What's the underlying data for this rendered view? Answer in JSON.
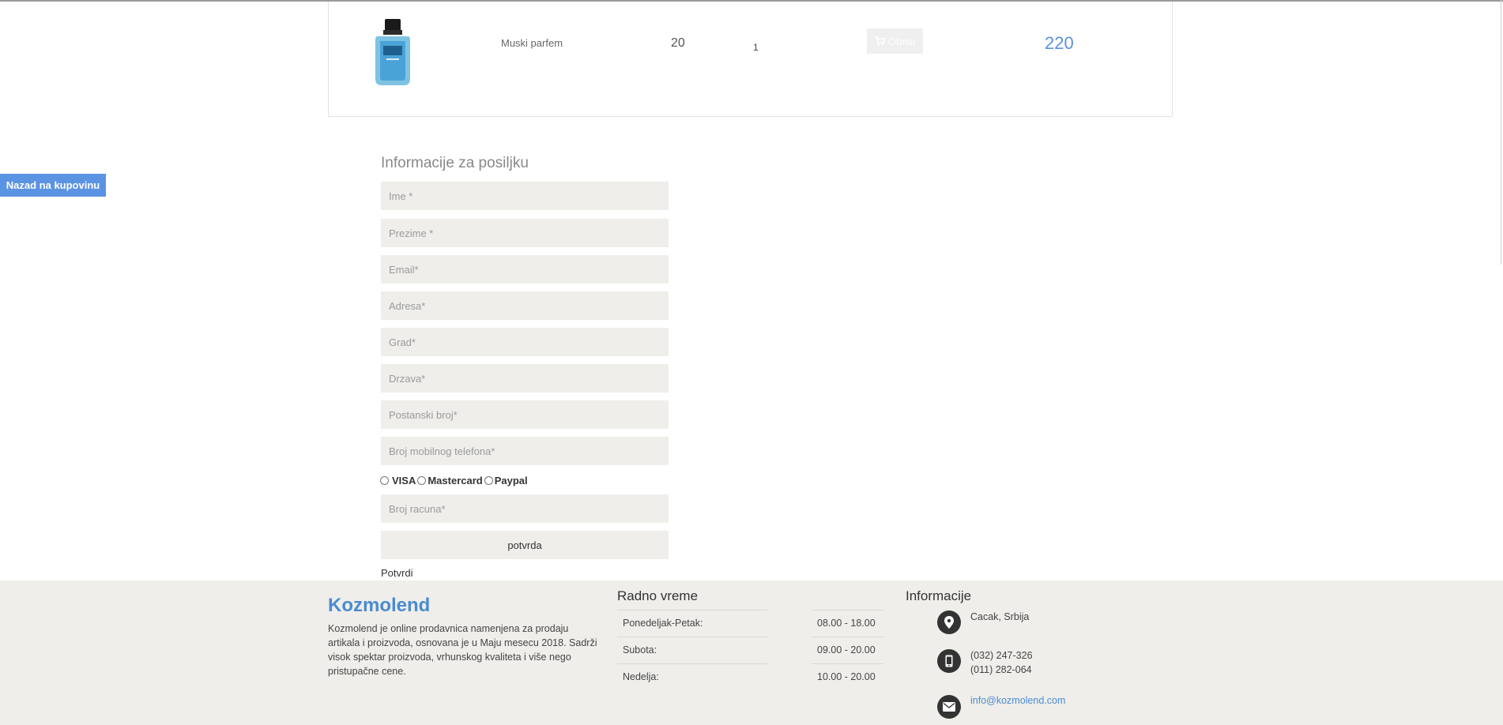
{
  "cart": {
    "product_name": "Muski parfem",
    "price": "20",
    "quantity": "1",
    "remove_label": "Obrisi",
    "total": "220"
  },
  "nav": {
    "back_label": "Nazad na kupovinu"
  },
  "form": {
    "title": "Informacije za posiljku",
    "placeholders": {
      "first_name": "Ime *",
      "last_name": "Prezime *",
      "email": "Email*",
      "address": "Adresa*",
      "city": "Grad*",
      "country": "Drzava*",
      "postal": "Postanski broj*",
      "phone": "Broj mobilnog telefona*",
      "account": "Broj racuna*"
    },
    "payment_options": [
      "VISA",
      "Mastercard",
      "Paypal"
    ],
    "confirm_button": "potvrda",
    "confirm_text": "Potvrdi"
  },
  "footer": {
    "brand": "Kozmolend",
    "about": "Kozmolend je online prodavnica namenjena za prodaju artikala i proizvoda, osnovana je u Maju mesecu 2018. Sadrži visok spektar proizvoda, vrhunskog kvaliteta i više nego pristupačne cene.",
    "hours_title": "Radno vreme",
    "hours": [
      {
        "day": "Ponedeljak-Petak:",
        "time": "08.00 - 18.00"
      },
      {
        "day": "Subota:",
        "time": "09.00 - 20.00"
      },
      {
        "day": "Nedelja:",
        "time": "10.00 - 20.00"
      }
    ],
    "info_title": "Informacije",
    "location": "Cacak, Srbija",
    "phone_1": "(032) 247-326",
    "phone_2": "(011) 282-064",
    "email": "info@kozmolend.com"
  }
}
